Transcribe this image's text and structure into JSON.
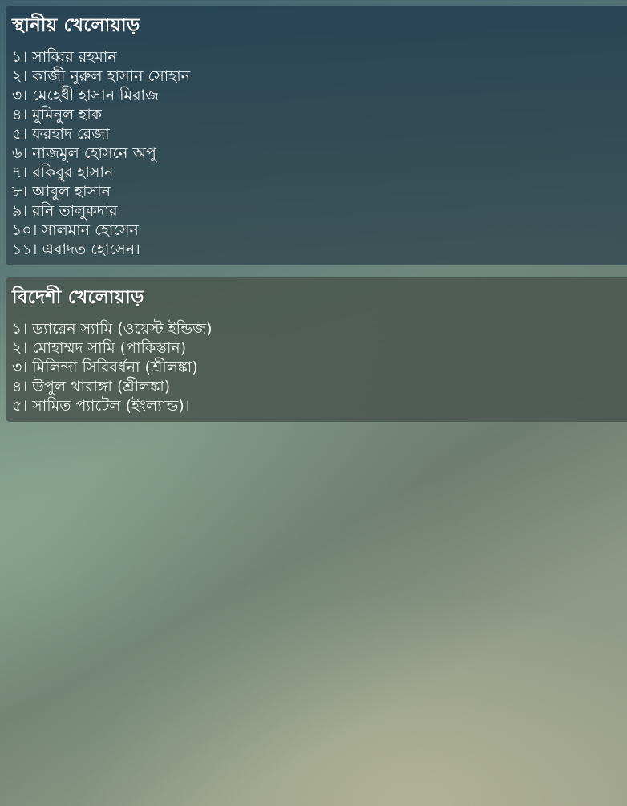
{
  "local": {
    "title": "স্থানীয় খেলোয়াড়",
    "players": [
      "১। সাব্বির রহমান",
      "২। কাজী নুরুল হাসান সোহান",
      "৩। মেহেধী হাসান মিরাজ",
      "৪। মুমিনুল হাক",
      "৫। ফরহাদ রেজা",
      "৬। নাজমুল হোসনে অপু",
      "৭। রকিবুর হাসান",
      "৮। আবুল হাসান",
      "৯। রনি তালুকদার",
      "১০। সালমান হোসেন",
      "১১। এবাদত হোসেন।"
    ]
  },
  "foreign": {
    "title": "বিদেশী খেলোয়াড়",
    "players": [
      "১। ড্যারেন স্যামি (ওয়েস্ট ইন্ডিজ)",
      "২। মোহাম্মদ সামি (পাকিস্তান)",
      "৩। মিলিন্দা সিরিবর্ধনা (শ্রীলঙ্কা)",
      "৪। উপুল থারাঙ্গা (শ্রীলঙ্কা)",
      "৫। সামিত প্যাটেল (ইংল্যান্ড)।"
    ]
  },
  "colors": {
    "panel_local": "#264254",
    "panel_foreign": "#4a5650",
    "text": "#ffffff"
  }
}
